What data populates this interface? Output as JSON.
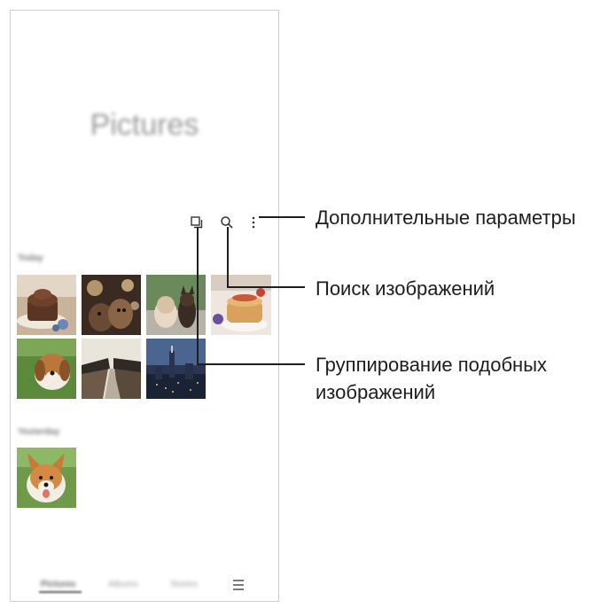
{
  "app": {
    "title": "Pictures"
  },
  "toolbar": {
    "icons": [
      "group-similar-icon",
      "search-icon",
      "more-options-icon"
    ]
  },
  "sections": [
    {
      "label": "Today"
    },
    {
      "label": "Yesterday"
    }
  ],
  "thumbnails_today": [
    "chocolate-cake",
    "dogs-with-sparkles",
    "kitten-and-chihuahua",
    "pancakes",
    "beagle-on-grass",
    "village-road",
    "city-skyline-night"
  ],
  "thumbnails_yesterday": [
    "corgi"
  ],
  "tabbar": {
    "pictures": "Pictures",
    "albums": "Albums",
    "stories": "Stories",
    "menu_icon": "menu-icon"
  },
  "callouts": {
    "more_options": "Дополнительные параметры",
    "search": "Поиск изображений",
    "group_line1": "Группирование подобных",
    "group_line2": "изображений"
  },
  "colors": {
    "line": "#1f1f1f",
    "frame": "#cfcfcf"
  }
}
